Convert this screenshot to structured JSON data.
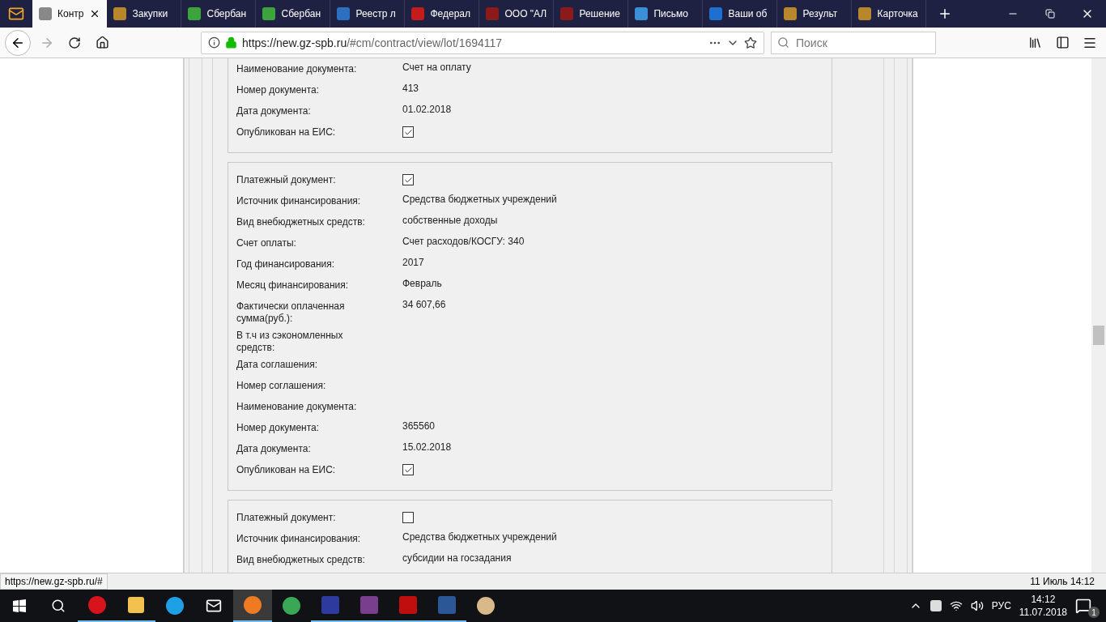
{
  "tabs": [
    {
      "label": "Контр",
      "selected": true
    },
    {
      "label": "Закупки",
      "selected": false
    },
    {
      "label": "Сбербан",
      "selected": false
    },
    {
      "label": "Сбербан",
      "selected": false
    },
    {
      "label": "Реестр л",
      "selected": false
    },
    {
      "label": "Федерал",
      "selected": false
    },
    {
      "label": "ООО \"АЛ",
      "selected": false
    },
    {
      "label": "Решение",
      "selected": false
    },
    {
      "label": "Письмо",
      "selected": false
    },
    {
      "label": "Ваши об",
      "selected": false
    },
    {
      "label": "Результ",
      "selected": false
    },
    {
      "label": "Карточка",
      "selected": false
    }
  ],
  "address_bar": {
    "url_host": "https://new.gz-spb.ru",
    "url_path": "/#cm/contract/view/lot/1694117"
  },
  "search": {
    "placeholder": "Поиск"
  },
  "cards": [
    {
      "cut_top": true,
      "rows": [
        {
          "kind": "text",
          "label": "Наименование документа:",
          "value": "Счет на оплату"
        },
        {
          "kind": "text",
          "label": "Номер документа:",
          "value": "413"
        },
        {
          "kind": "text",
          "label": "Дата документа:",
          "value": "01.02.2018"
        },
        {
          "kind": "checkbox",
          "label": "Опубликован на ЕИС:",
          "checked": true
        }
      ]
    },
    {
      "cut_top": false,
      "rows": [
        {
          "kind": "checkbox",
          "label": "Платежный документ:",
          "checked": true
        },
        {
          "kind": "text",
          "label": "Источник финансирования:",
          "value": "Средства бюджетных учреждений"
        },
        {
          "kind": "text",
          "label": "Вид внебюджетных средств:",
          "value": "собственные доходы"
        },
        {
          "kind": "text",
          "label": "Счет оплаты:",
          "value": "Счет расходов/КОСГУ: 340"
        },
        {
          "kind": "text",
          "label": "Год финансирования:",
          "value": "2017"
        },
        {
          "kind": "text",
          "label": "Месяц финансирования:",
          "value": "Февраль"
        },
        {
          "kind": "text",
          "label": "Фактически оплаченная сумма(руб.):",
          "value": "34 607,66"
        },
        {
          "kind": "text",
          "label": "В т.ч из сэкономленных средств:"
        },
        {
          "kind": "text",
          "label": "Дата соглашения:"
        },
        {
          "kind": "text",
          "label": "Номер соглашения:"
        },
        {
          "kind": "text",
          "label": "Наименование документа:"
        },
        {
          "kind": "text",
          "label": "Номер документа:",
          "value": "365560"
        },
        {
          "kind": "text",
          "label": "Дата документа:",
          "value": "15.02.2018"
        },
        {
          "kind": "checkbox",
          "label": "Опубликован на ЕИС:",
          "checked": true
        }
      ]
    },
    {
      "cut_top": false,
      "rows": [
        {
          "kind": "checkbox",
          "label": "Платежный документ:",
          "checked": false
        },
        {
          "kind": "text",
          "label": "Источник финансирования:",
          "value": "Средства бюджетных учреждений"
        },
        {
          "kind": "text",
          "label": "Вид внебюджетных средств:",
          "value": "субсидии на госзадания"
        }
      ]
    }
  ],
  "status_url": "https://new.gz-spb.ru/#",
  "status_date": "11 Июль 14:12",
  "taskbar": {
    "language": "РУС",
    "time": "14:12",
    "date": "11.07.2018",
    "notifications": "1"
  }
}
